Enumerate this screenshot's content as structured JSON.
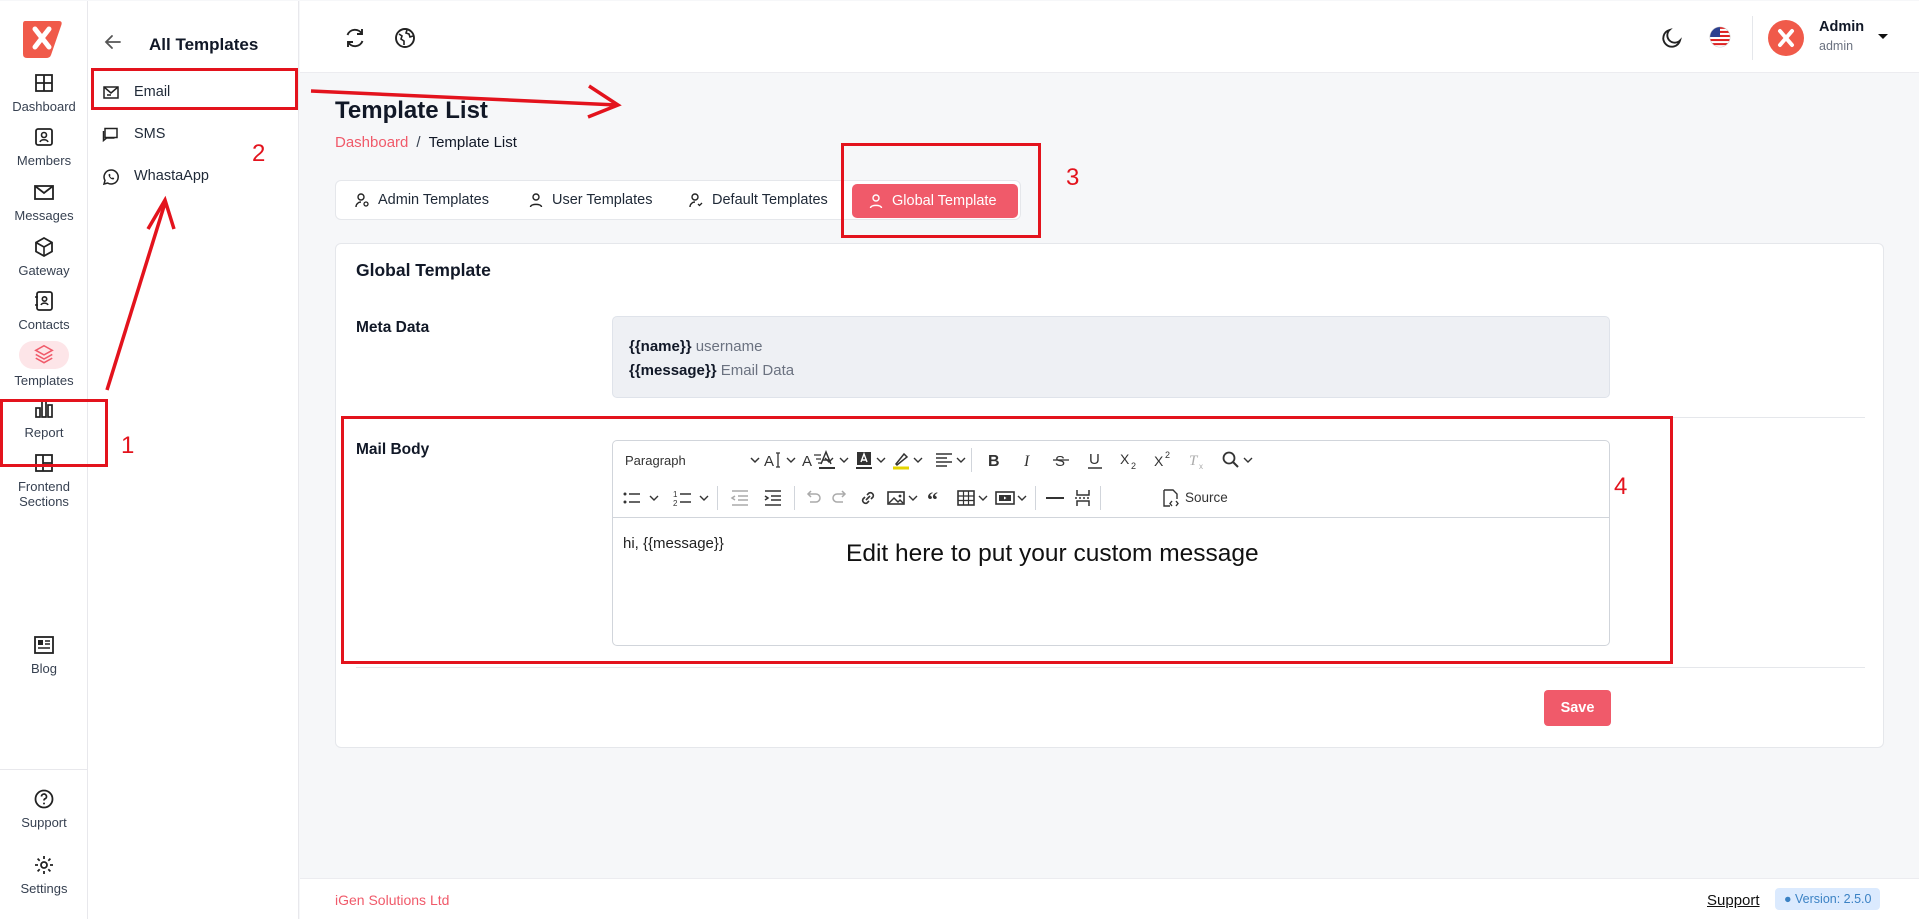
{
  "colors": {
    "accent": "#f05a6a",
    "annotation": "#e3131d",
    "brand_logo": "#f05a4a"
  },
  "rail": {
    "items": [
      {
        "label": "Dashboard",
        "icon": "grid-icon"
      },
      {
        "label": "Members",
        "icon": "id-card-icon"
      },
      {
        "label": "Messages",
        "icon": "envelope-icon"
      },
      {
        "label": "Gateway",
        "icon": "cube-icon"
      },
      {
        "label": "Contacts",
        "icon": "address-book-icon"
      },
      {
        "label": "Templates",
        "icon": "layers-icon",
        "active": true
      },
      {
        "label": "Report",
        "icon": "bar-chart-icon"
      },
      {
        "label_line1": "Frontend",
        "label_line2": "Sections",
        "icon": "layout-icon"
      },
      {
        "label": "Blog",
        "icon": "newspaper-icon"
      }
    ],
    "bottom": [
      {
        "label": "Support",
        "icon": "help-circle-icon"
      },
      {
        "label": "Settings",
        "icon": "gear-icon"
      }
    ]
  },
  "subnav": {
    "title": "All Templates",
    "items": [
      {
        "label": "Email",
        "icon": "mail-icon"
      },
      {
        "label": "SMS",
        "icon": "chat-icon"
      },
      {
        "label": "WhastaApp",
        "icon": "whatsapp-icon"
      }
    ]
  },
  "topbar": {
    "user_name": "Admin",
    "user_role": "admin"
  },
  "page": {
    "title": "Template List",
    "breadcrumb": {
      "parent": "Dashboard",
      "separator": "/",
      "current": "Template List"
    }
  },
  "tabs": [
    {
      "label": "Admin Templates"
    },
    {
      "label": "User Templates"
    },
    {
      "label": "Default Templates"
    },
    {
      "label": "Global Template",
      "active": true
    }
  ],
  "card": {
    "title": "Global Template",
    "meta_label": "Meta Data",
    "meta": [
      {
        "key": "{{name}}",
        "desc": "username"
      },
      {
        "key": "{{message}}",
        "desc": "Email Data"
      }
    ],
    "body_label": "Mail Body",
    "editor": {
      "paragraph_select": "Paragraph",
      "source_label": "Source",
      "content": "hi, {{message}}"
    },
    "save_label": "Save"
  },
  "annotations": {
    "edit_hint": "Edit here to put your custom message",
    "numbers": [
      "1",
      "2",
      "3",
      "4"
    ]
  },
  "footer": {
    "company": "iGen Solutions Ltd",
    "support": "Support",
    "version": "Version: 2.5.0"
  }
}
